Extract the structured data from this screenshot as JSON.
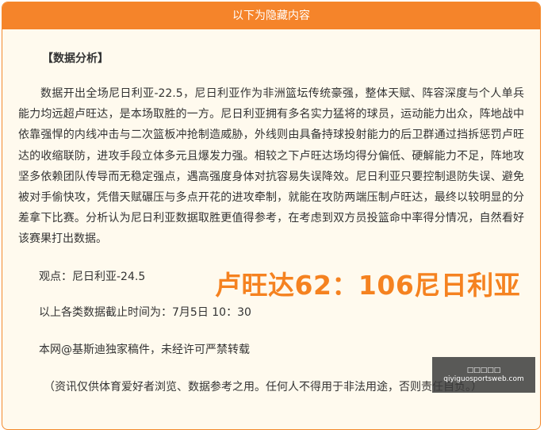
{
  "panel": {
    "header": "以下为隐藏内容"
  },
  "article": {
    "heading": "【数据分析】",
    "paragraph": "数据开出全场尼日利亚-22.5，尼日利亚作为非洲篮坛传统豪强，整体天赋、阵容深度与个人单兵能力均远超卢旺达，是本场取胜的一方。尼日利亚拥有多名实力猛将的球员，运动能力出众，阵地战中依靠强悍的内线冲击与二次篮板冲抢制造威胁，外线则由具备持球投射能力的后卫群通过挡拆惩罚卢旺达的收缩联防，进攻手段立体多元且爆发力强。相较之下卢旺达场均得分偏低、硬解能力不足，阵地攻坚多依赖团队传导而无稳定强点，遇高强度身体对抗容易失误降效。尼日利亚只要控制退防失误、避免被对手偷快攻，凭借天赋碾压与多点开花的进攻牵制，就能在攻防两端压制卢旺达，最终以较明显的分差拿下比赛。分析认为尼日利亚数据取胜更值得参考，在考虑到双方员投篮命中率得分情况，自然看好该赛果打出数据。",
    "viewpoint": "观点：尼日利亚-24.5",
    "score": "卢旺达62：106尼日利亚",
    "cutoff": "以上各类数据截止时间为：7月5日 10：30",
    "copyright": "本网@基斯迪独家稿件，未经许可严禁转载",
    "disclaimer": "（资讯仅供体育爱好者浏览、数据参考之用。任何人不得用于非法用途，否则责任自负。）"
  },
  "watermark": {
    "line1": "□□□□□",
    "line2": "qiyiguosportsweb.com"
  }
}
